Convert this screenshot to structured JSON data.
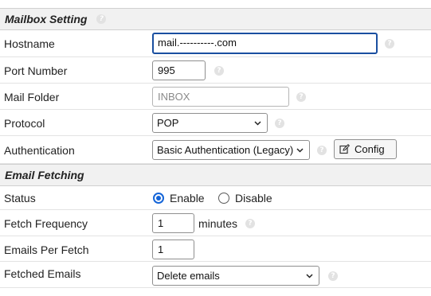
{
  "mailbox_section": {
    "title": "Mailbox Setting",
    "help_icon": "question-icon"
  },
  "hostname": {
    "label": "Hostname",
    "value": "mail.----------.com"
  },
  "port": {
    "label": "Port Number",
    "value": "995"
  },
  "mail_folder": {
    "label": "Mail Folder",
    "placeholder": "INBOX"
  },
  "protocol": {
    "label": "Protocol",
    "selected": "POP"
  },
  "authentication": {
    "label": "Authentication",
    "selected": "Basic Authentication (Legacy)",
    "config_label": "Config"
  },
  "fetching_section": {
    "title": "Email Fetching"
  },
  "status": {
    "label": "Status",
    "enable_label": "Enable",
    "disable_label": "Disable",
    "selected": "Enable"
  },
  "fetch_frequency": {
    "label": "Fetch Frequency",
    "value": "1",
    "unit": "minutes"
  },
  "emails_per_fetch": {
    "label": "Emails Per Fetch",
    "value": "1"
  },
  "fetched_emails": {
    "label": "Fetched Emails",
    "selected": "Delete emails"
  },
  "colors": {
    "focus_border": "#1a4fa0",
    "radio_accent": "#1565d8",
    "header_bg": "#f1f1f1"
  }
}
